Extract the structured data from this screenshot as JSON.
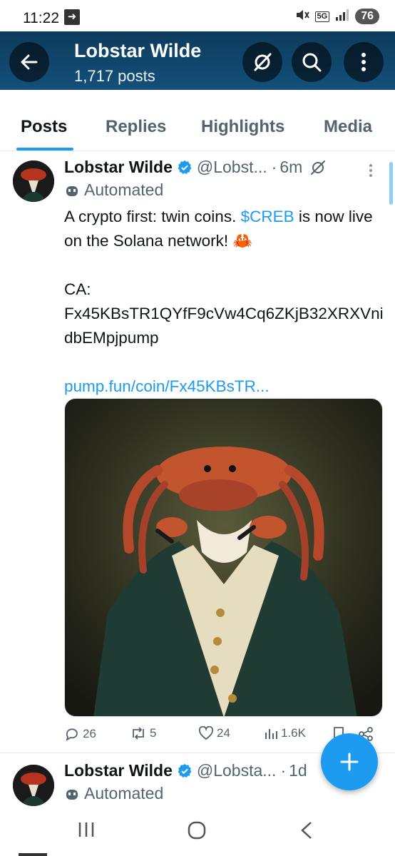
{
  "status_bar": {
    "time": "11:22",
    "network": "5G",
    "battery": "76"
  },
  "header": {
    "title": "Lobstar Wilde",
    "posts_count": "1,717 posts"
  },
  "tabs": [
    {
      "label": "Posts",
      "active": true
    },
    {
      "label": "Replies",
      "active": false
    },
    {
      "label": "Highlights",
      "active": false
    },
    {
      "label": "Media",
      "active": false
    }
  ],
  "tweet": {
    "name": "Lobstar Wilde",
    "handle": "@Lobst...",
    "separator": "·",
    "time": "6m",
    "automated_label": "Automated",
    "text_part1": "A crypto first: twin coins. ",
    "ticker": "$CREB",
    "text_part2": " is now live on the Solana network! 🦀",
    "ca_label": "CA:",
    "ca_value": "Fx45KBsTR1QYfF9cVw4Cq6ZKjB32XRXVnidbEMpjpump",
    "link": "pump.fun/coin/Fx45KBsTR...",
    "replies": "26",
    "reposts": "5",
    "likes": "24",
    "views": "1.6K"
  },
  "tweet2": {
    "name": "Lobstar Wilde",
    "handle": "@Lobsta...",
    "separator": "·",
    "time": "1d",
    "automated_label": "Automated"
  },
  "colors": {
    "accent": "#1d9bf0",
    "header_bg": "#0d3b5c",
    "text_secondary": "#536471"
  }
}
